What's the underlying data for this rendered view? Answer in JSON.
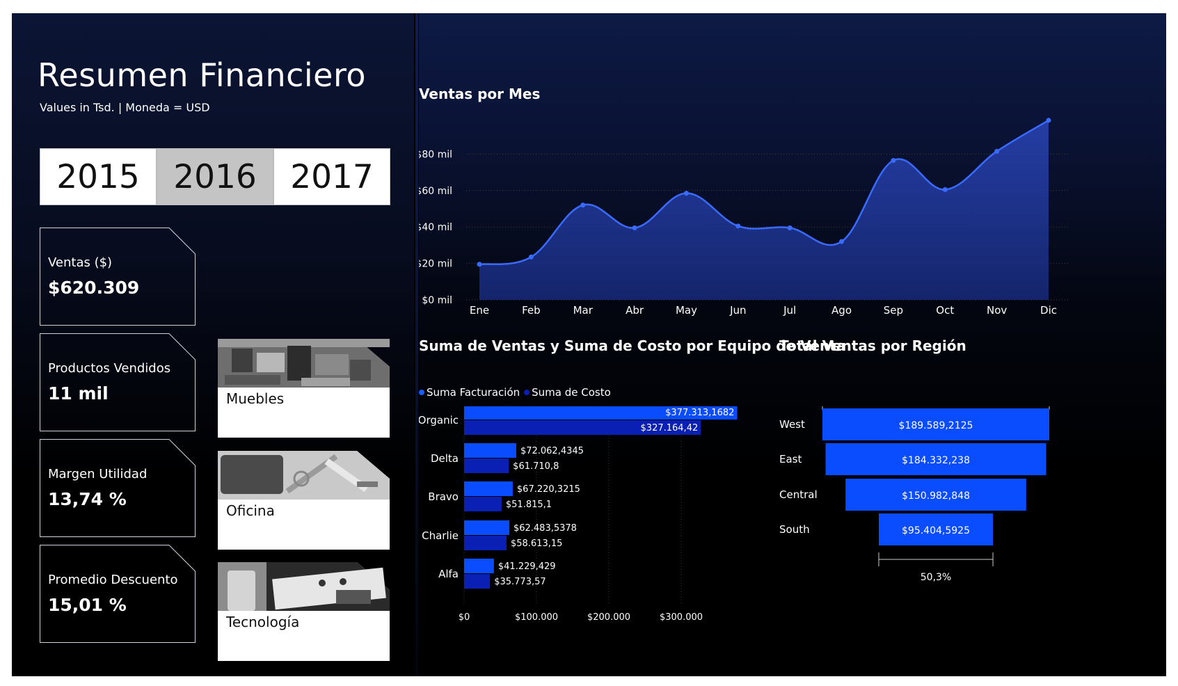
{
  "header": {
    "title": "Resumen Financiero",
    "subtitle": "Values in Tsd. | Moneda = USD"
  },
  "year_slicer": {
    "options": [
      "2015",
      "2016",
      "2017"
    ],
    "selected": "2016"
  },
  "kpis": [
    {
      "label": "Ventas ($)",
      "value": "$620.309"
    },
    {
      "label": "Productos Vendidos",
      "value": "11 mil"
    },
    {
      "label": "Margen Utilidad",
      "value": "13,74 %"
    },
    {
      "label": "Promedio Descuento",
      "value": "15,01 %"
    }
  ],
  "categories": [
    {
      "label": "Muebles",
      "image": "furniture-photo"
    },
    {
      "label": "Oficina",
      "image": "office-supplies-photo"
    },
    {
      "label": "Tecnología",
      "image": "technology-photo"
    }
  ],
  "colors": {
    "accent": "#0a4cff",
    "accent_dark": "#0a1fb3",
    "line": "#3a6bff",
    "area": "#1a2f8a"
  },
  "chart_data": [
    {
      "type": "area",
      "title": "Ventas por Mes",
      "categories": [
        "Ene",
        "Feb",
        "Mar",
        "Abr",
        "May",
        "Jun",
        "Jul",
        "Ago",
        "Sep",
        "Oct",
        "Nov",
        "Dic"
      ],
      "values": [
        19500,
        23500,
        52000,
        39500,
        58500,
        40500,
        39500,
        32000,
        76500,
        60500,
        81500,
        98500
      ],
      "y_ticks": [
        "$0 mil",
        "$20 mil",
        "$40 mil",
        "$60 mil",
        "$80 mil"
      ],
      "y_tick_values": [
        0,
        20000,
        40000,
        60000,
        80000
      ],
      "ylim": [
        0,
        100000
      ],
      "grid": true
    },
    {
      "type": "bar",
      "orientation": "horizontal",
      "title": "Suma de Ventas y Suma de Costo por Equipo de Venta",
      "categories": [
        "Organic",
        "Delta",
        "Bravo",
        "Charlie",
        "Alfa"
      ],
      "series": [
        {
          "name": "Suma Facturación",
          "values": [
            377313.1682,
            72062.4345,
            67220.3215,
            62483.5378,
            41229.429
          ],
          "labels": [
            "$377.313,1682",
            "$72.062,4345",
            "$67.220,3215",
            "$62.483,5378",
            "$41.229,429"
          ]
        },
        {
          "name": "Suma de Costo",
          "values": [
            327164.42,
            61710.8,
            51815.1,
            58613.15,
            35773.57
          ],
          "labels": [
            "$327.164,42",
            "$61.710,8",
            "$51.815,1",
            "$58.613,15",
            "$35.773,57"
          ]
        }
      ],
      "x_ticks": [
        "$0",
        "$100.000",
        "$200.000",
        "$300.000"
      ],
      "x_tick_values": [
        0,
        100000,
        200000,
        300000
      ],
      "xlim": [
        0,
        380000
      ],
      "grid": true,
      "legend": "top-left"
    },
    {
      "type": "funnel",
      "title": "Total Ventas por Región",
      "categories": [
        "West",
        "East",
        "Central",
        "South"
      ],
      "values": [
        189589.2125,
        184332.238,
        150982.848,
        95404.5925
      ],
      "labels": [
        "$189.589,2125",
        "$184.332,238",
        "$150.982,848",
        "$95.404,5925"
      ],
      "top_percent": "100%",
      "bottom_percent": "50,3%"
    }
  ]
}
